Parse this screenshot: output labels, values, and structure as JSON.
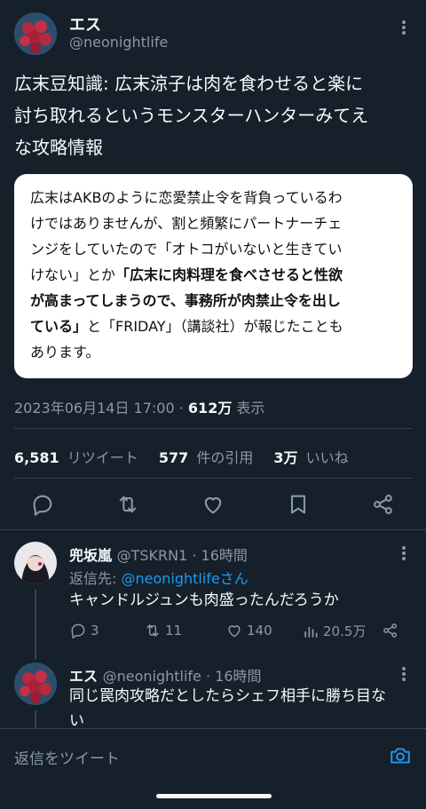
{
  "tweet": {
    "author_name": "エス",
    "author_handle": "@neonightlife",
    "text_line1": "広末豆知識: 広末涼子は肉を食わせると楽に",
    "text_line2": "討ち取れるというモンスターハンターみてえ",
    "text_line3": "な攻略情報",
    "quote": {
      "line1": "広末はAKBのように恋愛禁止令を背負っているわ",
      "line2": "けではありませんが、割と頻繁にパートナーチェ",
      "line3": "ンジをしていたので「オトコがいないと生きてい",
      "line4a": "けない」とか",
      "line4b": "「広末に肉料理を食べさせると性欲",
      "line5": "が高まってしまうので、事務所が肉禁止令を出し",
      "line6a": "ている」",
      "line6b": "と「FRIDAY」（講談社）が報じたことも",
      "line7": "あります。"
    },
    "datetime": "2023年06月14日 17:00",
    "separator": "·",
    "views_count": "612万",
    "views_label": "表示",
    "retweets_count": "6,581",
    "retweets_label": "リツイート",
    "quotes_count": "577",
    "quotes_label": "件の引用",
    "likes_count": "3万",
    "likes_label": "いいね"
  },
  "icons": {
    "reply": "reply-icon",
    "retweet": "retweet-icon",
    "like": "heart-icon",
    "bookmark": "bookmark-icon",
    "share": "share-icon",
    "more": "more-icon",
    "views": "views-icon",
    "camera": "camera-icon"
  },
  "replies": [
    {
      "name": "兜坂嵐",
      "handle_time": "@TSKRN1 · 16時間",
      "reply_to_label": "返信先: ",
      "reply_to_handle": "@neonightlifeさん",
      "text": "キャンドルジュンも肉盛ったんだろうか",
      "reply_count": "3",
      "retweet_count": "11",
      "like_count": "140",
      "views_count": "20.5万"
    },
    {
      "name": "エス",
      "handle_time": "@neonightlife · 16時間",
      "text_line1": "同じ罠肉攻略だとしたらシェフ相手に勝ち目な",
      "text_line2": "い"
    }
  ],
  "composer": {
    "placeholder": "返信をツイート"
  },
  "colors": {
    "background": "#15202b",
    "accent": "#1d9bf0",
    "secondary_text": "#8b98a5"
  }
}
